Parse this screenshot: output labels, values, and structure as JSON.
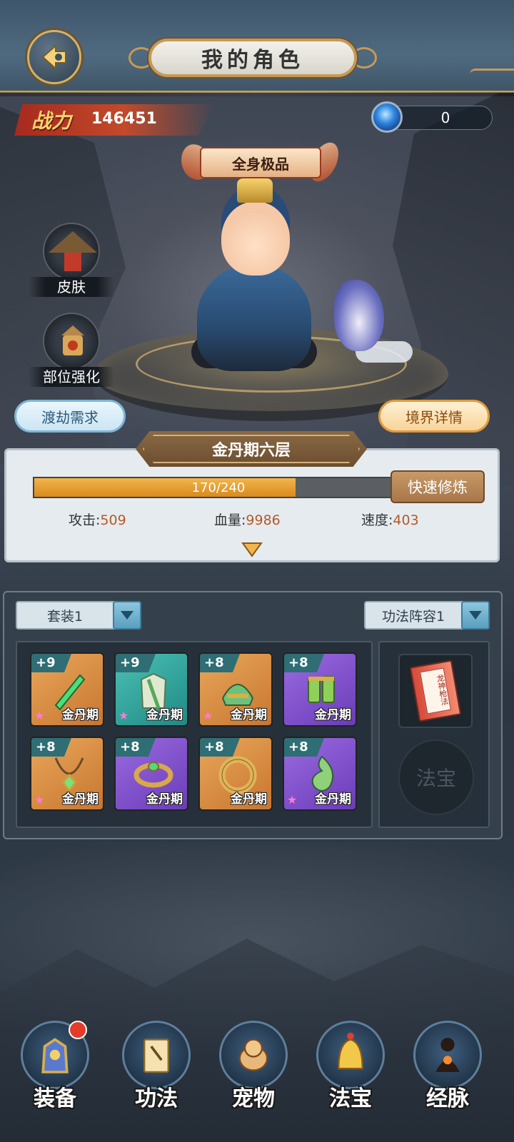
{
  "header": {
    "title": "我的角色"
  },
  "power": {
    "label": "战力",
    "value": "146451"
  },
  "currency": {
    "icon": "blue-orb-icon",
    "value": "0"
  },
  "quality_banner": "全身极品",
  "side_buttons": [
    {
      "label": "皮肤",
      "icon": "straw-hat-icon"
    },
    {
      "label": "部位强化",
      "icon": "pagoda-icon"
    }
  ],
  "actions": {
    "tribulation": "渡劫需求",
    "realm_details": "境界详情"
  },
  "realm": {
    "title": "金丹期六层",
    "progress_text": "170/240",
    "progress_current": 170,
    "progress_max": 240,
    "train_button": "快速修炼",
    "stats": [
      {
        "label": "攻击:",
        "value": "509"
      },
      {
        "label": "血量:",
        "value": "9986"
      },
      {
        "label": "速度:",
        "value": "403"
      }
    ]
  },
  "equipment": {
    "set_dropdown": "套装1",
    "skill_dropdown": "功法阵容1",
    "slots": [
      {
        "level": "+9",
        "realm": "金丹期",
        "item": "sword-icon",
        "rarity": "orange",
        "star": true
      },
      {
        "level": "+9",
        "realm": "金丹期",
        "item": "robe-icon",
        "rarity": "teal",
        "star": true
      },
      {
        "level": "+8",
        "realm": "金丹期",
        "item": "helmet-icon",
        "rarity": "orange",
        "star": true
      },
      {
        "level": "+8",
        "realm": "金丹期",
        "item": "boots-icon",
        "rarity": "purple",
        "star": false
      },
      {
        "level": "+8",
        "realm": "金丹期",
        "item": "necklace-icon",
        "rarity": "orange",
        "star": true
      },
      {
        "level": "+8",
        "realm": "金丹期",
        "item": "bracelet-icon",
        "rarity": "purple",
        "star": false
      },
      {
        "level": "+8",
        "realm": "金丹期",
        "item": "ring-icon",
        "rarity": "orange",
        "star": false
      },
      {
        "level": "+8",
        "realm": "金丹期",
        "item": "jade-pendant-icon",
        "rarity": "purple",
        "star": true
      }
    ],
    "book_title": "龙神枪法",
    "treasure_slot": "法宝"
  },
  "nav": [
    {
      "label": "装备",
      "icon": "armor-icon",
      "badge": true
    },
    {
      "label": "功法",
      "icon": "scroll-book-icon",
      "badge": false
    },
    {
      "label": "宠物",
      "icon": "pet-dragon-icon",
      "badge": false
    },
    {
      "label": "法宝",
      "icon": "golden-bell-icon",
      "badge": false
    },
    {
      "label": "经脉",
      "icon": "meridian-figure-icon",
      "badge": false
    }
  ],
  "colors": {
    "accent_gold": "#c59a55",
    "power_red": "#a62a1e",
    "progress_orange": "#e9a038",
    "stat_value": "#b55a24"
  }
}
